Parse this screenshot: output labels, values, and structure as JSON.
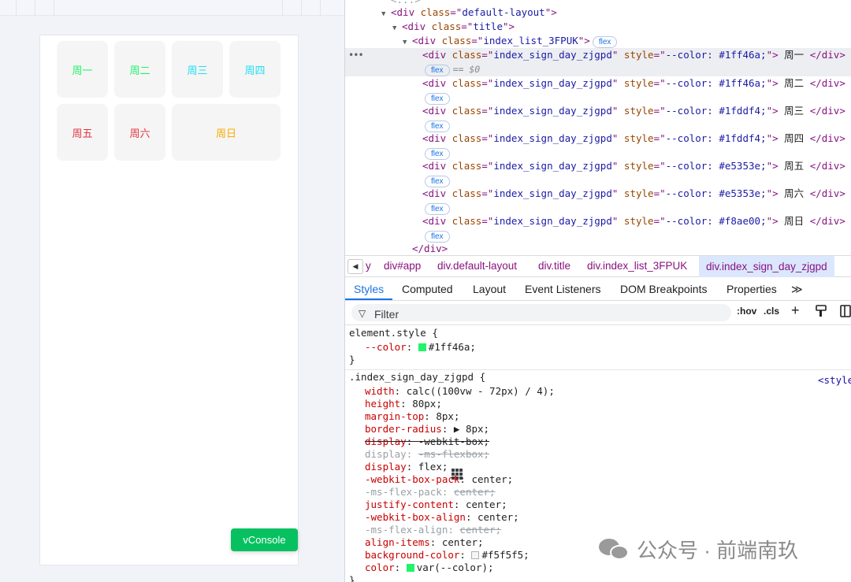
{
  "preview": {
    "days": [
      {
        "label": "周一",
        "color": "#1ff46a"
      },
      {
        "label": "周二",
        "color": "#1ff46a"
      },
      {
        "label": "周三",
        "color": "#1fddf4"
      },
      {
        "label": "周四",
        "color": "#1fddf4"
      },
      {
        "label": "周五",
        "color": "#e5353e"
      },
      {
        "label": "周六",
        "color": "#e5353e"
      },
      {
        "label": "周日",
        "color": "#f8ae00"
      }
    ],
    "vconsole_label": "vConsole"
  },
  "dom": {
    "lines": [
      {
        "tri": "▼",
        "tag": "div",
        "attr": "class",
        "value": "default-layout"
      },
      {
        "tri": "▼",
        "tag": "div",
        "attr": "class",
        "value": "title"
      },
      {
        "tri": "▼",
        "tag": "div",
        "attr": "class",
        "value": "index_list_3FPUK",
        "badge": "flex"
      }
    ],
    "children": [
      {
        "class": "index_sign_day_zjgpd",
        "style": "--color: #1ff46a;",
        "text": "周一",
        "selected": true
      },
      {
        "class": "index_sign_day_zjgpd",
        "style": "--color: #1ff46a;",
        "text": "周二"
      },
      {
        "class": "index_sign_day_zjgpd",
        "style": "--color: #1fddf4;",
        "text": "周三"
      },
      {
        "class": "index_sign_day_zjgpd",
        "style": "--color: #1fddf4;",
        "text": "周四"
      },
      {
        "class": "index_sign_day_zjgpd",
        "style": "--color: #e5353e;",
        "text": "周五"
      },
      {
        "class": "index_sign_day_zjgpd",
        "style": "--color: #e5353e;",
        "text": "周六"
      },
      {
        "class": "index_sign_day_zjgpd",
        "style": "--color: #f8ae00;",
        "text": "周日"
      }
    ],
    "badge_label": "flex",
    "selected_marker": "== $0",
    "close_tag": "</div>",
    "ellipsis": "•••"
  },
  "breadcrumbs": {
    "back_icon": "◀",
    "items": [
      "y",
      "div#app",
      "div.default-layout",
      "div.title",
      "div.index_list_3FPUK",
      "div.index_sign_day_zjgpd"
    ]
  },
  "tabs": {
    "items": [
      "Styles",
      "Computed",
      "Layout",
      "Event Listeners",
      "DOM Breakpoints",
      "Properties"
    ],
    "more": "≫",
    "active": "Styles"
  },
  "filter": {
    "placeholder": "Filter",
    "hov": ":hov",
    "cls": ".cls",
    "plus": "+"
  },
  "styles": {
    "element_style": {
      "selector": "element.style {",
      "prop": "--color",
      "value": "#1ff46a;",
      "swatch": "#1ff46a",
      "close": "}"
    },
    "rule": {
      "selector": ".index_sign_day_zjgpd {",
      "source": "<style",
      "declarations": [
        {
          "prop": "width",
          "value": "calc((100vw - 72px) / 4);",
          "state": "on"
        },
        {
          "prop": "height",
          "value": "80px;",
          "state": "on"
        },
        {
          "prop": "margin-top",
          "value": "8px;",
          "state": "on"
        },
        {
          "prop": "border-radius",
          "value": "▶ 8px;",
          "state": "on"
        },
        {
          "prop": "display",
          "value": "-webkit-box;",
          "state": "struck"
        },
        {
          "prop": "display",
          "value": "-ms-flexbox;",
          "state": "off"
        },
        {
          "prop": "display",
          "value": "flex;",
          "state": "on",
          "flex_icon": true
        },
        {
          "prop": "-webkit-box-pack",
          "value": "center;",
          "state": "on"
        },
        {
          "prop": "-ms-flex-pack",
          "value": "center;",
          "state": "off"
        },
        {
          "prop": "justify-content",
          "value": "center;",
          "state": "on"
        },
        {
          "prop": "-webkit-box-align",
          "value": "center;",
          "state": "on"
        },
        {
          "prop": "-ms-flex-align",
          "value": "center;",
          "state": "off"
        },
        {
          "prop": "align-items",
          "value": "center;",
          "state": "on"
        },
        {
          "prop": "background-color",
          "value": "#f5f5f5;",
          "state": "on",
          "swatch": "#f5f5f5"
        },
        {
          "prop": "color",
          "value": "var(--color);",
          "state": "on",
          "swatch": "#1ff46a"
        }
      ],
      "close": "}"
    }
  },
  "watermark": {
    "text": "公众号 · 前端南玖"
  }
}
